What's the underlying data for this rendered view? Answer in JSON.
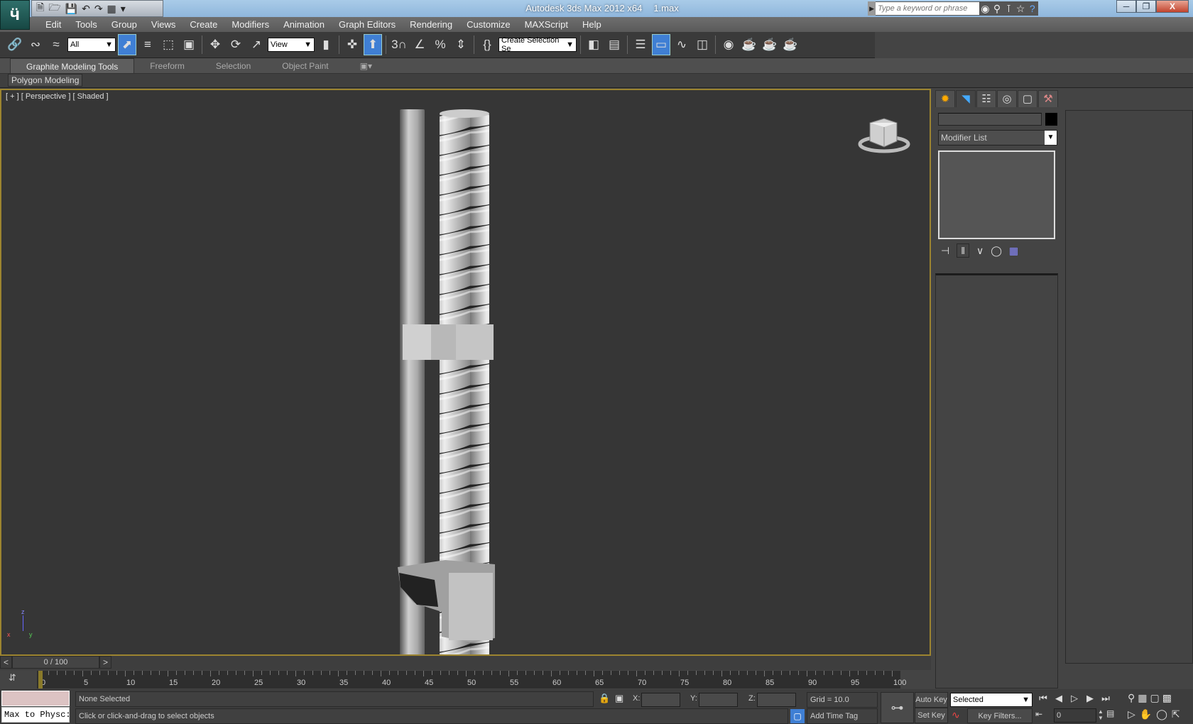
{
  "app": {
    "title": "Autodesk 3ds Max  2012 x64",
    "file": "1.max",
    "logo": "3ds-max-logo"
  },
  "quick_access": [
    "new-file-icon",
    "open-file-icon",
    "save-icon",
    "undo-icon",
    "redo-icon",
    "project-folder-icon",
    "customize-dropdown-icon"
  ],
  "search": {
    "placeholder": "Type a keyword or phrase"
  },
  "title_icons": [
    "binoculars-icon",
    "key-icon",
    "satellite-icon",
    "star-icon",
    "help-icon"
  ],
  "menu": [
    "Edit",
    "Tools",
    "Group",
    "Views",
    "Create",
    "Modifiers",
    "Animation",
    "Graph Editors",
    "Rendering",
    "Customize",
    "MAXScript",
    "Help"
  ],
  "toolbar": {
    "selection_filter": "All",
    "ref_coord": "View",
    "named_selection": "Create Selection Se"
  },
  "ribbon": {
    "tabs": [
      "Graphite Modeling Tools",
      "Freeform",
      "Selection",
      "Object Paint"
    ],
    "panel": "Polygon Modeling"
  },
  "viewport": {
    "label": "[ + ] [ Perspective ] [ Shaded ]",
    "axes": {
      "x": "x",
      "y": "y",
      "z": "z"
    }
  },
  "command_panel": {
    "tabs": [
      "create-icon",
      "modify-icon",
      "hierarchy-icon",
      "motion-icon",
      "display-icon",
      "utilities-icon"
    ],
    "modifier_list": "Modifier List",
    "object_color": "#000000"
  },
  "time_slider": {
    "label": "0 / 100",
    "prev": "<",
    "next": ">",
    "current": 0,
    "end": 100
  },
  "track": {
    "labels": [
      "0",
      "5",
      "10",
      "15",
      "20",
      "25",
      "30",
      "35",
      "40",
      "45",
      "50",
      "55",
      "60",
      "65",
      "70",
      "75",
      "80",
      "85",
      "90",
      "95",
      "100"
    ]
  },
  "status": {
    "listener": "Max to Physc:",
    "selection": "None Selected",
    "prompt": "Click or click-and-drag to select objects",
    "x_label": "X:",
    "y_label": "Y:",
    "z_label": "Z:",
    "grid": "Grid = 10.0",
    "add_time_tag": "Add Time Tag"
  },
  "anim": {
    "auto_key": "Auto Key",
    "set_key": "Set Key",
    "key_mode": "Selected",
    "key_filters": "Key Filters...",
    "frame": "0"
  },
  "colors": {
    "viewport_border": "#9c8430",
    "active_button": "#3f7fd4",
    "viewport_bg": "#363636"
  }
}
